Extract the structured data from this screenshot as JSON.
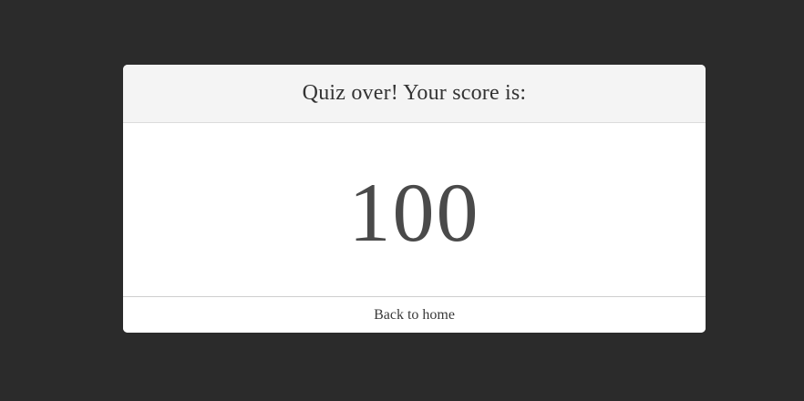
{
  "result": {
    "title": "Quiz over! Your score is:",
    "score": "100",
    "back_label": "Back to home"
  },
  "colors": {
    "background": "#2b2b2b",
    "card": "#ffffff",
    "header": "#f4f4f4",
    "text": "#333333"
  }
}
